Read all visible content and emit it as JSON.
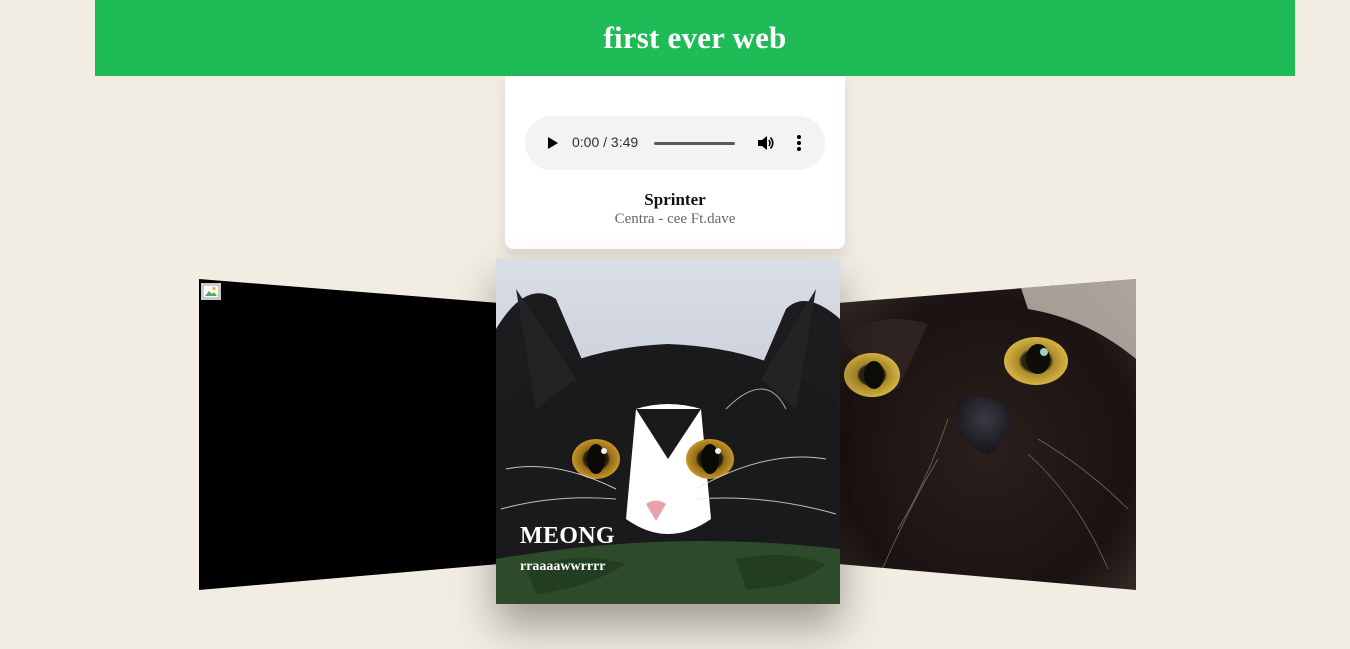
{
  "header": {
    "title": "first ever web",
    "bg_color": "#1fbb57"
  },
  "player": {
    "time_display": "0:00 / 3:49",
    "progress": 0,
    "song_title": "Sprinter",
    "song_artist": "Centra - cee Ft.dave",
    "play_icon": "play-icon",
    "volume_icon": "volume-icon",
    "menu_icon": "more-vert-icon"
  },
  "gallery": {
    "left_image": "broken-image-icon",
    "center_caption_title": "MEONG",
    "center_caption_sub": "rraaaawwrrrr",
    "center_image": "black-white-cat-photo",
    "right_image": "black-cat-closeup-photo"
  },
  "colors": {
    "page_bg": "#f2ede3",
    "accent": "#1fbb57"
  }
}
